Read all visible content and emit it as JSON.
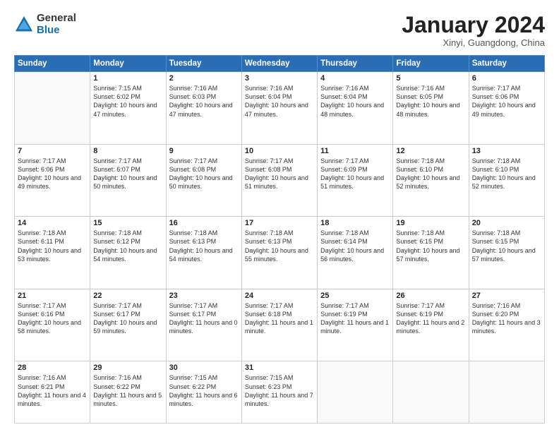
{
  "logo": {
    "general": "General",
    "blue": "Blue"
  },
  "title": "January 2024",
  "location": "Xinyi, Guangdong, China",
  "days_of_week": [
    "Sunday",
    "Monday",
    "Tuesday",
    "Wednesday",
    "Thursday",
    "Friday",
    "Saturday"
  ],
  "weeks": [
    [
      {
        "day": "",
        "info": ""
      },
      {
        "day": "1",
        "info": "Sunrise: 7:15 AM\nSunset: 6:02 PM\nDaylight: 10 hours\nand 47 minutes."
      },
      {
        "day": "2",
        "info": "Sunrise: 7:16 AM\nSunset: 6:03 PM\nDaylight: 10 hours\nand 47 minutes."
      },
      {
        "day": "3",
        "info": "Sunrise: 7:16 AM\nSunset: 6:04 PM\nDaylight: 10 hours\nand 47 minutes."
      },
      {
        "day": "4",
        "info": "Sunrise: 7:16 AM\nSunset: 6:04 PM\nDaylight: 10 hours\nand 48 minutes."
      },
      {
        "day": "5",
        "info": "Sunrise: 7:16 AM\nSunset: 6:05 PM\nDaylight: 10 hours\nand 48 minutes."
      },
      {
        "day": "6",
        "info": "Sunrise: 7:17 AM\nSunset: 6:06 PM\nDaylight: 10 hours\nand 49 minutes."
      }
    ],
    [
      {
        "day": "7",
        "info": "Sunrise: 7:17 AM\nSunset: 6:06 PM\nDaylight: 10 hours\nand 49 minutes."
      },
      {
        "day": "8",
        "info": "Sunrise: 7:17 AM\nSunset: 6:07 PM\nDaylight: 10 hours\nand 50 minutes."
      },
      {
        "day": "9",
        "info": "Sunrise: 7:17 AM\nSunset: 6:08 PM\nDaylight: 10 hours\nand 50 minutes."
      },
      {
        "day": "10",
        "info": "Sunrise: 7:17 AM\nSunset: 6:08 PM\nDaylight: 10 hours\nand 51 minutes."
      },
      {
        "day": "11",
        "info": "Sunrise: 7:17 AM\nSunset: 6:09 PM\nDaylight: 10 hours\nand 51 minutes."
      },
      {
        "day": "12",
        "info": "Sunrise: 7:18 AM\nSunset: 6:10 PM\nDaylight: 10 hours\nand 52 minutes."
      },
      {
        "day": "13",
        "info": "Sunrise: 7:18 AM\nSunset: 6:10 PM\nDaylight: 10 hours\nand 52 minutes."
      }
    ],
    [
      {
        "day": "14",
        "info": "Sunrise: 7:18 AM\nSunset: 6:11 PM\nDaylight: 10 hours\nand 53 minutes."
      },
      {
        "day": "15",
        "info": "Sunrise: 7:18 AM\nSunset: 6:12 PM\nDaylight: 10 hours\nand 54 minutes."
      },
      {
        "day": "16",
        "info": "Sunrise: 7:18 AM\nSunset: 6:13 PM\nDaylight: 10 hours\nand 54 minutes."
      },
      {
        "day": "17",
        "info": "Sunrise: 7:18 AM\nSunset: 6:13 PM\nDaylight: 10 hours\nand 55 minutes."
      },
      {
        "day": "18",
        "info": "Sunrise: 7:18 AM\nSunset: 6:14 PM\nDaylight: 10 hours\nand 56 minutes."
      },
      {
        "day": "19",
        "info": "Sunrise: 7:18 AM\nSunset: 6:15 PM\nDaylight: 10 hours\nand 57 minutes."
      },
      {
        "day": "20",
        "info": "Sunrise: 7:18 AM\nSunset: 6:15 PM\nDaylight: 10 hours\nand 57 minutes."
      }
    ],
    [
      {
        "day": "21",
        "info": "Sunrise: 7:17 AM\nSunset: 6:16 PM\nDaylight: 10 hours\nand 58 minutes."
      },
      {
        "day": "22",
        "info": "Sunrise: 7:17 AM\nSunset: 6:17 PM\nDaylight: 10 hours\nand 59 minutes."
      },
      {
        "day": "23",
        "info": "Sunrise: 7:17 AM\nSunset: 6:17 PM\nDaylight: 11 hours\nand 0 minutes."
      },
      {
        "day": "24",
        "info": "Sunrise: 7:17 AM\nSunset: 6:18 PM\nDaylight: 11 hours\nand 1 minute."
      },
      {
        "day": "25",
        "info": "Sunrise: 7:17 AM\nSunset: 6:19 PM\nDaylight: 11 hours\nand 1 minute."
      },
      {
        "day": "26",
        "info": "Sunrise: 7:17 AM\nSunset: 6:19 PM\nDaylight: 11 hours\nand 2 minutes."
      },
      {
        "day": "27",
        "info": "Sunrise: 7:16 AM\nSunset: 6:20 PM\nDaylight: 11 hours\nand 3 minutes."
      }
    ],
    [
      {
        "day": "28",
        "info": "Sunrise: 7:16 AM\nSunset: 6:21 PM\nDaylight: 11 hours\nand 4 minutes."
      },
      {
        "day": "29",
        "info": "Sunrise: 7:16 AM\nSunset: 6:22 PM\nDaylight: 11 hours\nand 5 minutes."
      },
      {
        "day": "30",
        "info": "Sunrise: 7:15 AM\nSunset: 6:22 PM\nDaylight: 11 hours\nand 6 minutes."
      },
      {
        "day": "31",
        "info": "Sunrise: 7:15 AM\nSunset: 6:23 PM\nDaylight: 11 hours\nand 7 minutes."
      },
      {
        "day": "",
        "info": ""
      },
      {
        "day": "",
        "info": ""
      },
      {
        "day": "",
        "info": ""
      }
    ]
  ]
}
